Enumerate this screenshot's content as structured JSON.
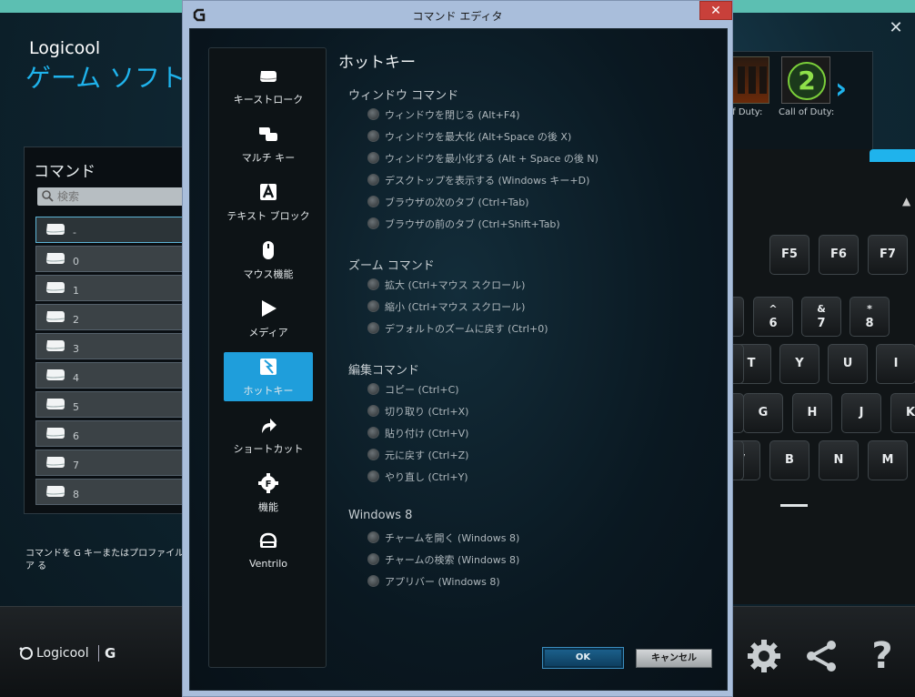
{
  "app": {
    "brand": "Logicool",
    "subtitle": "ゲーム ソフトウ",
    "close": "✕",
    "command_panel": {
      "title": "コマンド",
      "search_placeholder": "検索",
      "items": [
        {
          "label": "-"
        },
        {
          "label": "0"
        },
        {
          "label": "1"
        },
        {
          "label": "2"
        },
        {
          "label": "3"
        },
        {
          "label": "4"
        },
        {
          "label": "5"
        },
        {
          "label": "6"
        },
        {
          "label": "7"
        },
        {
          "label": "8"
        }
      ]
    },
    "help_text": "コマンドを G キーまたはプロファイル ア る",
    "games": [
      {
        "label": "of Duty:"
      },
      {
        "label": "Call of Duty:",
        "badge": "2"
      }
    ],
    "keyboard": {
      "fkeys": [
        "F5",
        "F6",
        "F7"
      ],
      "num_row": [
        {
          "top": "^",
          "main": "6"
        },
        {
          "top": "&",
          "main": "7"
        },
        {
          "top": "*",
          "main": "8"
        }
      ],
      "row_q": [
        "T",
        "Y",
        "U",
        "I"
      ],
      "row_a": [
        "G",
        "H",
        "J",
        "K"
      ],
      "row_z": [
        "V",
        "B",
        "N",
        "M"
      ]
    },
    "footer": {
      "logo_text": "Logicool",
      "logo_mark": "G"
    }
  },
  "dialog": {
    "title": "コマンド エディタ",
    "close": "✕",
    "categories": [
      {
        "label": "キーストローク",
        "icon": "key-icon"
      },
      {
        "label": "マルチ キー",
        "icon": "multikey-icon"
      },
      {
        "label": "テキスト ブロック",
        "icon": "text-block-icon"
      },
      {
        "label": "マウス機能",
        "icon": "mouse-icon"
      },
      {
        "label": "メディア",
        "icon": "play-icon"
      },
      {
        "label": "ホットキー",
        "icon": "hotkey-icon"
      },
      {
        "label": "ショートカット",
        "icon": "shortcut-arrow-icon"
      },
      {
        "label": "機能",
        "icon": "function-gear-icon"
      },
      {
        "label": "Ventrilo",
        "icon": "ventrilo-headset-icon"
      }
    ],
    "selected_category": "ホットキー",
    "section_title": "ホットキー",
    "groups": [
      {
        "title": "ウィンドウ コマンド",
        "options": [
          "ウィンドウを閉じる (Alt+F4)",
          "ウィンドウを最大化 (Alt+Space の後 X)",
          "ウィンドウを最小化する (Alt + Space の後 N)",
          "デスクトップを表示する (Windows キー+D)",
          "ブラウザの次のタブ (Ctrl+Tab)",
          "ブラウザの前のタブ (Ctrl+Shift+Tab)"
        ]
      },
      {
        "title": "ズーム コマンド",
        "options": [
          "拡大 (Ctrl+マウス スクロール)",
          "縮小 (Ctrl+マウス スクロール)",
          "デフォルトのズームに戻す (Ctrl+0)"
        ]
      },
      {
        "title": "編集コマンド",
        "options": [
          "コピー (Ctrl+C)",
          "切り取り (Ctrl+X)",
          "貼り付け (Ctrl+V)",
          "元に戻す (Ctrl+Z)",
          "やり直し (Ctrl+Y)"
        ]
      },
      {
        "title": "Windows 8",
        "options": [
          "チャームを開く (Windows 8)",
          "チャームの検索 (Windows 8)",
          "アプリバー (Windows 8)"
        ]
      }
    ],
    "ok_label": "OK",
    "cancel_label": "キャンセル"
  },
  "colors": {
    "accent": "#1f9edb",
    "dialog_frame": "#a9bedb",
    "close_red": "#c8403a"
  }
}
